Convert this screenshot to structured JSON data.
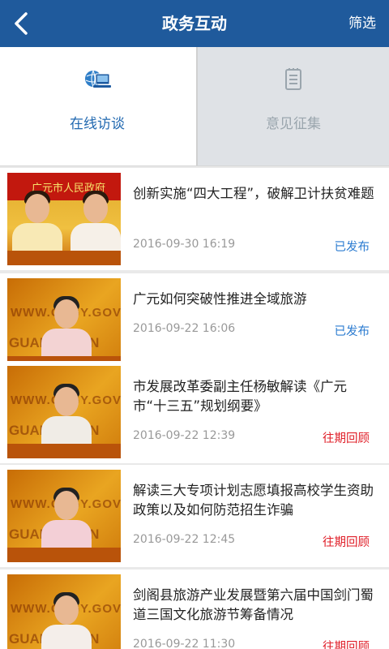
{
  "header": {
    "title": "政务互动",
    "filter_label": "筛选"
  },
  "tabs": [
    {
      "label": "在线访谈",
      "icon": "online-interview-icon",
      "active": true
    },
    {
      "label": "意见征集",
      "icon": "opinion-collection-icon",
      "active": false
    }
  ],
  "thumb_watermarks": {
    "first": "广元市人民政府",
    "site": "WWW.CNGY.GOV.",
    "site2": "GUANGYUAN"
  },
  "items": [
    {
      "title": "创新实施“四大工程”，破解卫计扶贫难题",
      "date": "2016-09-30 16:19",
      "status": "已发布",
      "status_type": "published"
    },
    {
      "title": "广元如何突破性推进全域旅游",
      "date": "2016-09-22 16:06",
      "status": "已发布",
      "status_type": "published"
    },
    {
      "title": "市发展改革委副主任杨敏解读《广元市“十三五”规划纲要》",
      "date": "2016-09-22 12:39",
      "status": "往期回顾",
      "status_type": "review"
    },
    {
      "title": "解读三大专项计划志愿填报高校学生资助政策以及如何防范招生诈骗",
      "date": "2016-09-22 12:45",
      "status": "往期回顾",
      "status_type": "review"
    },
    {
      "title": "剑阁县旅游产业发展暨第六届中国剑门蜀道三国文化旅游节筹备情况",
      "date": "2016-09-22 11:30",
      "status": "往期回顾",
      "status_type": "review"
    }
  ],
  "colors": {
    "header_bg": "#1f5a9c",
    "published": "#2b7bd0",
    "review": "#e0202a"
  }
}
